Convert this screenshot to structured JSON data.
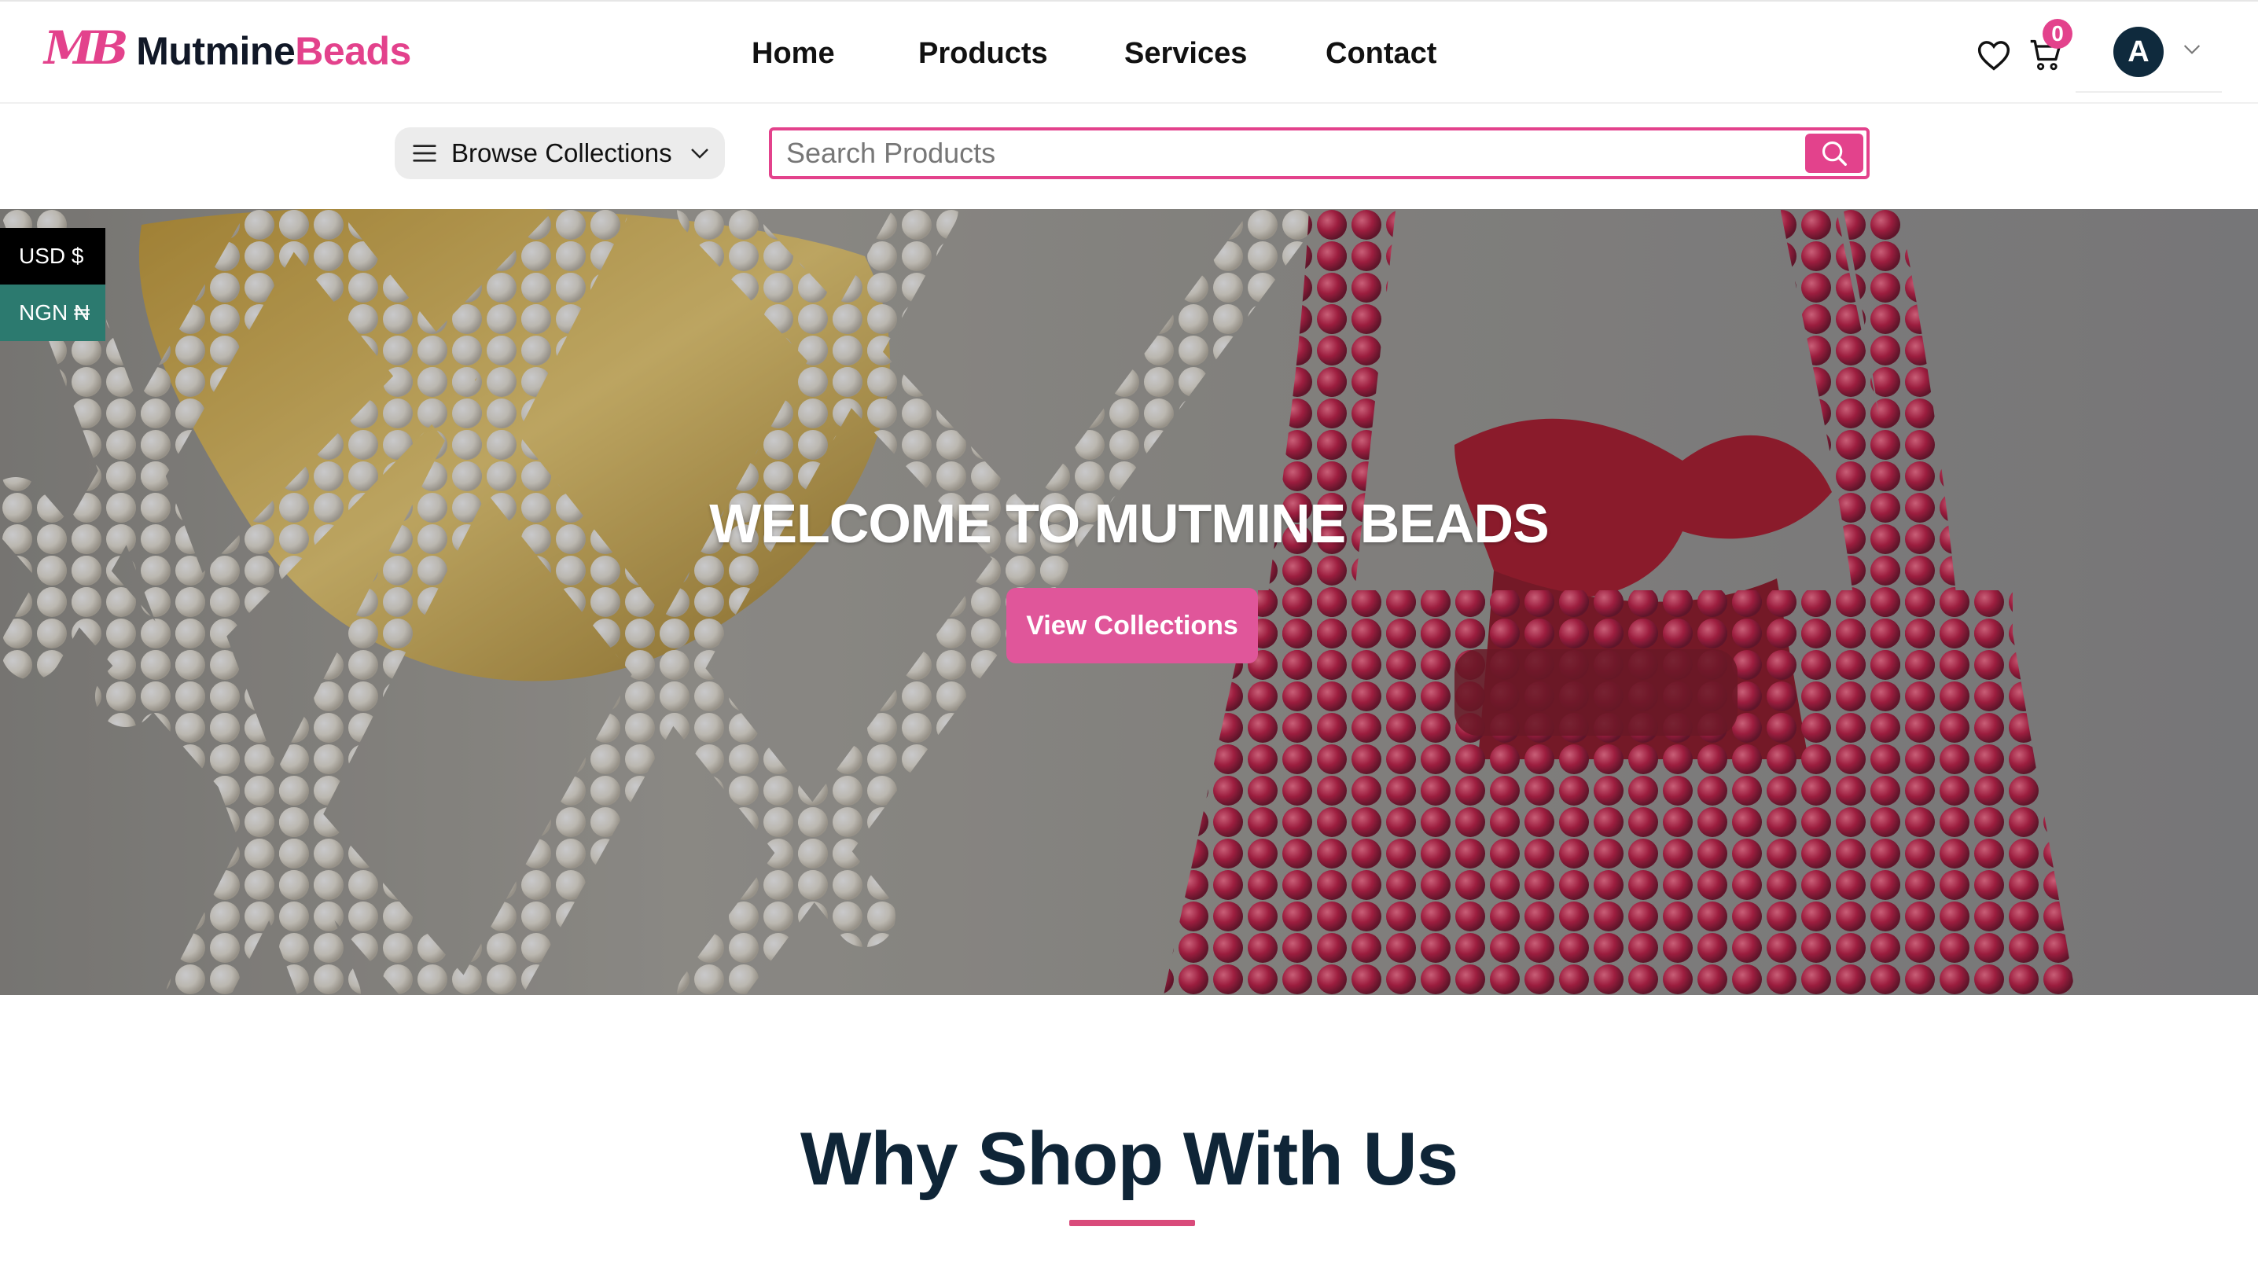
{
  "brand": {
    "mark": "MB",
    "name_dark": "Mutmine",
    "name_pink": "Beads"
  },
  "nav": {
    "items": [
      "Home",
      "Products",
      "Services",
      "Contact"
    ]
  },
  "header": {
    "cart_count": "0",
    "avatar_initial": "A"
  },
  "subbar": {
    "browse_label": "Browse Collections",
    "search_placeholder": "Search Products"
  },
  "currency": {
    "usd": "USD $",
    "ngn": "NGN ₦"
  },
  "hero": {
    "title": "WELCOME TO MUTMINE BEADS",
    "cta": "View Collections"
  },
  "why": {
    "title": "Why Shop With Us"
  },
  "colors": {
    "accent": "#e3428c",
    "navy": "#0f2537",
    "ngn_bg": "#2c7a6f"
  },
  "icons": [
    "menu-icon",
    "chevron-down-icon",
    "search-icon",
    "heart-icon",
    "cart-icon"
  ]
}
